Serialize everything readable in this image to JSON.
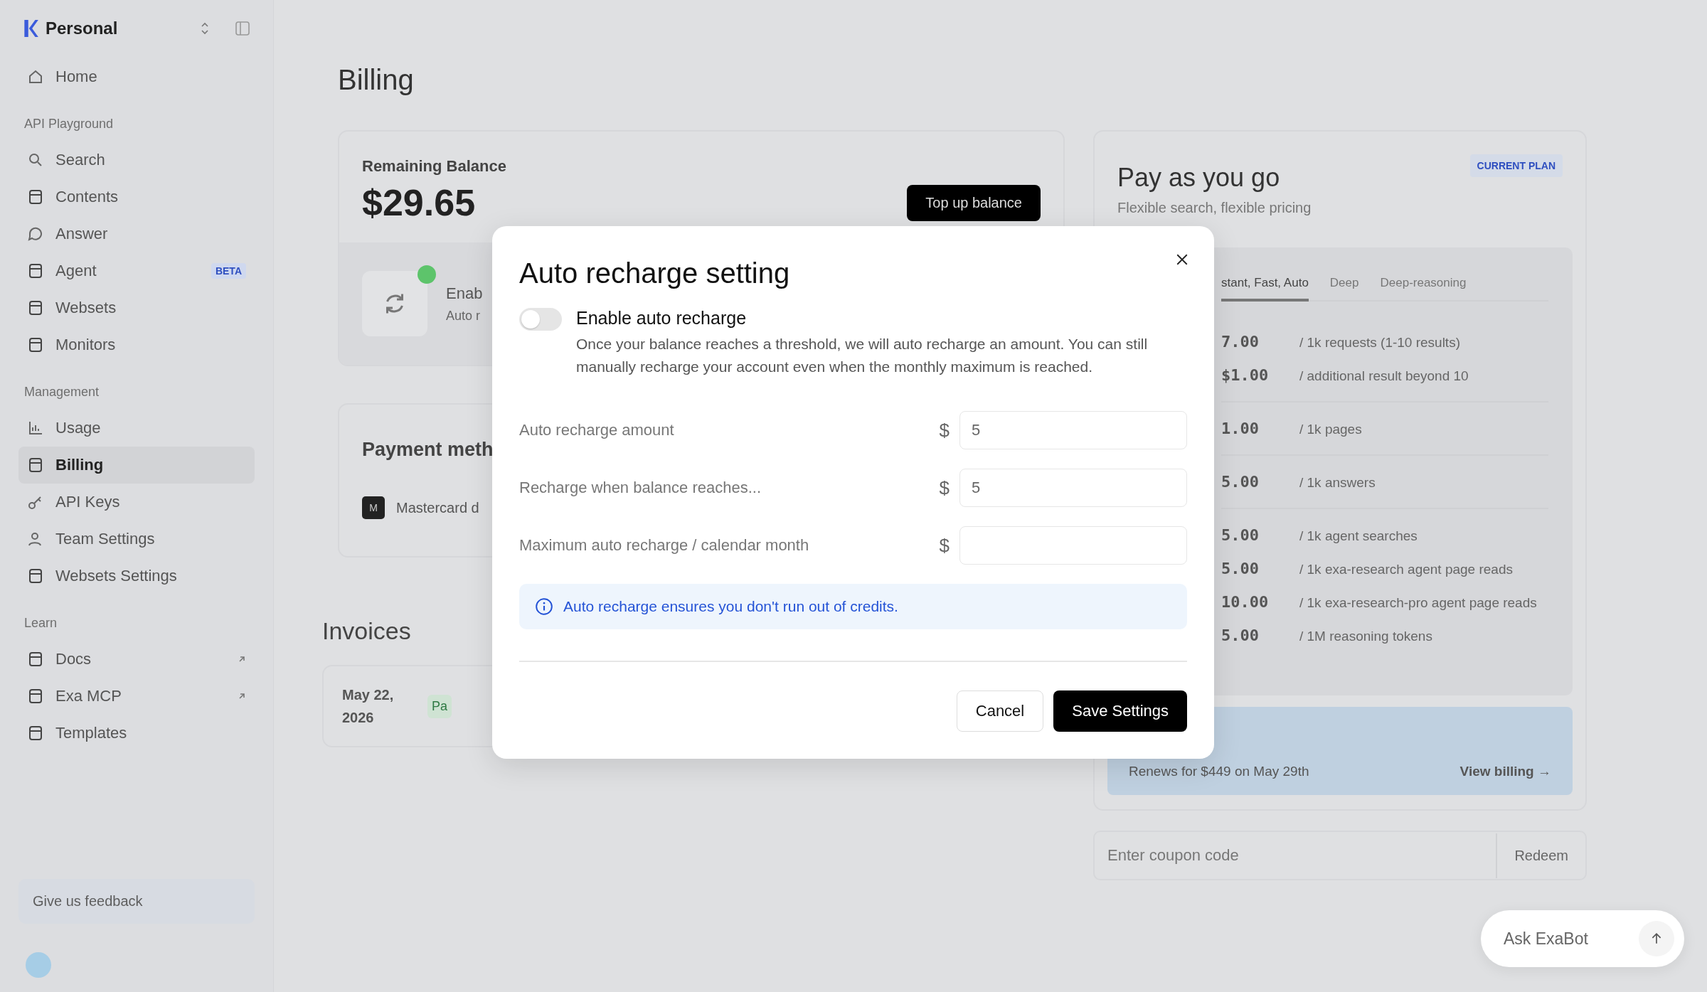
{
  "sidebar": {
    "workspace": "Personal",
    "sections": [
      {
        "items": [
          {
            "label": "Home",
            "selected": false
          }
        ]
      },
      {
        "heading": "API Playground",
        "items": [
          {
            "label": "Search",
            "selected": false
          },
          {
            "label": "Contents",
            "selected": false
          },
          {
            "label": "Answer",
            "selected": false
          },
          {
            "label": "Agent",
            "selected": false,
            "badge": "BETA"
          },
          {
            "label": "Websets",
            "selected": false
          },
          {
            "label": "Monitors",
            "selected": false
          }
        ]
      },
      {
        "heading": "Management",
        "items": [
          {
            "label": "Usage",
            "selected": false
          },
          {
            "label": "Billing",
            "selected": true
          },
          {
            "label": "API Keys",
            "selected": false
          },
          {
            "label": "Team Settings",
            "selected": false
          },
          {
            "label": "Websets Settings",
            "selected": false
          }
        ]
      },
      {
        "heading": "Learn",
        "items": [
          {
            "label": "Docs",
            "selected": false,
            "external": true
          },
          {
            "label": "Exa MCP",
            "selected": false,
            "external": true
          },
          {
            "label": "Templates",
            "selected": false
          }
        ]
      }
    ],
    "feedback": "Give us feedback"
  },
  "page": {
    "title": "Billing",
    "balance": {
      "label": "Remaining Balance",
      "amount": "$29.65",
      "button": "Top up balance",
      "auto_title": "Enab",
      "auto_text": "Auto r",
      "status_on": true
    },
    "payment": {
      "title": "Payment meth",
      "card_mark": "M",
      "card": "Mastercard d"
    },
    "invoices": {
      "title": "Invoices",
      "date": "May 22, 2026",
      "status": "Pa"
    },
    "plan": {
      "name": "Pay as you go",
      "subtitle": "Flexible search, flexible pricing",
      "badge": "CURRENT PLAN",
      "tabs": [
        {
          "label": "stant, Fast, Auto",
          "selected": true
        },
        {
          "label": "Deep",
          "selected": false
        },
        {
          "label": "Deep-reasoning",
          "selected": false
        }
      ],
      "price_groups": [
        [
          {
            "price": "7.00",
            "unit": "/ 1k requests (1-10 results)"
          },
          {
            "price": "$1.00",
            "unit": "/ additional result beyond 10"
          }
        ],
        [
          {
            "price": "1.00",
            "unit": "/ 1k pages"
          }
        ],
        [
          {
            "price": "5.00",
            "unit": "/ 1k answers"
          }
        ],
        [
          {
            "price": "5.00",
            "unit": "/ 1k agent searches"
          },
          {
            "price": "5.00",
            "unit": "/ 1k exa-research agent page reads"
          },
          {
            "price": "10.00",
            "unit": "/ 1k exa-research-pro agent page reads"
          },
          {
            "price": "5.00",
            "unit": "/ 1M reasoning tokens"
          }
        ]
      ],
      "renewal": "Renews for $449 on May 29th",
      "view_billing": "View billing →"
    },
    "coupon": {
      "placeholder": "Enter coupon code",
      "button": "Redeem"
    }
  },
  "modal": {
    "title": "Auto recharge setting",
    "toggle": {
      "label": "Enable auto recharge",
      "on": false,
      "description": "Once your balance reaches a threshold, we will auto recharge an amount. You can still manually recharge your account even when the monthly maximum is reached."
    },
    "fields": [
      {
        "label": "Auto recharge amount",
        "currency": "$",
        "value": "5"
      },
      {
        "label": "Recharge when balance reaches...",
        "currency": "$",
        "value": "5"
      },
      {
        "label": "Maximum auto recharge / calendar month",
        "currency": "$"
      }
    ],
    "info": "Auto recharge ensures you don't run out of credits.",
    "buttons": [
      {
        "label": "Cancel",
        "kind": "secondary"
      },
      {
        "label": "Save Settings",
        "kind": "primary"
      }
    ]
  },
  "chat": {
    "placeholder": "Ask ExaBot"
  }
}
